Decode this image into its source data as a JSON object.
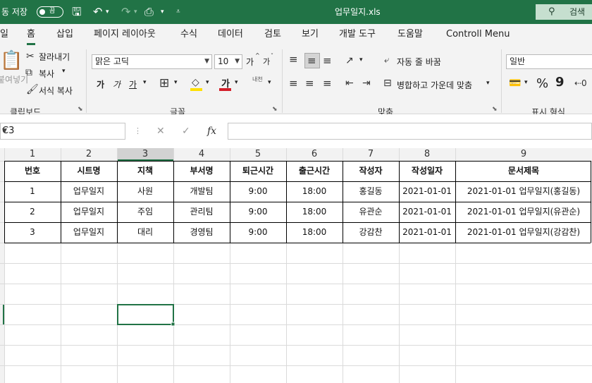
{
  "titlebar": {
    "autosave_label": "동 저장",
    "autosave_state": "끔",
    "filename": "업무일지.xls",
    "search_label": "검색"
  },
  "tabs": [
    "일",
    "홈",
    "삽입",
    "페이지 레이아웃",
    "수식",
    "데이터",
    "검토",
    "보기",
    "개발 도구",
    "도움말",
    "Controll Menu"
  ],
  "active_tab": "홈",
  "ribbon": {
    "clipboard": {
      "paste_label": "붙여넣기",
      "cut": "잘라내기",
      "copy": "복사",
      "format_painter": "서식 복사",
      "group_label": "클립보드"
    },
    "font": {
      "font_name": "맑은 고딕",
      "font_size": "10",
      "grow": "가",
      "shrink": "가",
      "bold": "가",
      "italic": "가",
      "underline": "가",
      "font_color_glyph": "가",
      "phonetic": "내천",
      "group_label": "글꼴"
    },
    "alignment": {
      "wrap_text": "자동 줄 바꿈",
      "merge_center": "병합하고 가운데 맞춤",
      "group_label": "맞춤"
    },
    "number": {
      "format": "일반",
      "percent": "%",
      "comma": "9",
      "group_label": "표시 형식"
    }
  },
  "formula_bar": {
    "name_box": "C3",
    "cancel": "✕",
    "enter": "✓",
    "fx": "fx",
    "value": ""
  },
  "sheet": {
    "column_headers": [
      "1",
      "2",
      "3",
      "4",
      "5",
      "6",
      "7",
      "8",
      "9"
    ],
    "selected_column": "3",
    "table_headers": [
      "번호",
      "시트명",
      "지책",
      "부서명",
      "퇴근시간",
      "출근시간",
      "작성자",
      "작성일자",
      "문서제목"
    ],
    "rows": [
      [
        "1",
        "업무일지",
        "사원",
        "개발팀",
        "9:00",
        "18:00",
        "홍길동",
        "2021-01-01",
        "2021-01-01 업무일지(홍길동)"
      ],
      [
        "2",
        "업무일지",
        "주임",
        "관리팀",
        "9:00",
        "18:00",
        "유관순",
        "2021-01-01",
        "2021-01-01 업무일지(유관순)"
      ],
      [
        "3",
        "업무일지",
        "대리",
        "경영팀",
        "9:00",
        "18:00",
        "강감찬",
        "2021-01-01",
        "2021-01-01 업무일지(강감찬)"
      ]
    ]
  },
  "colors": {
    "brand": "#217346",
    "font_color": "#d31f2a",
    "fill_color": "#ffe000"
  }
}
